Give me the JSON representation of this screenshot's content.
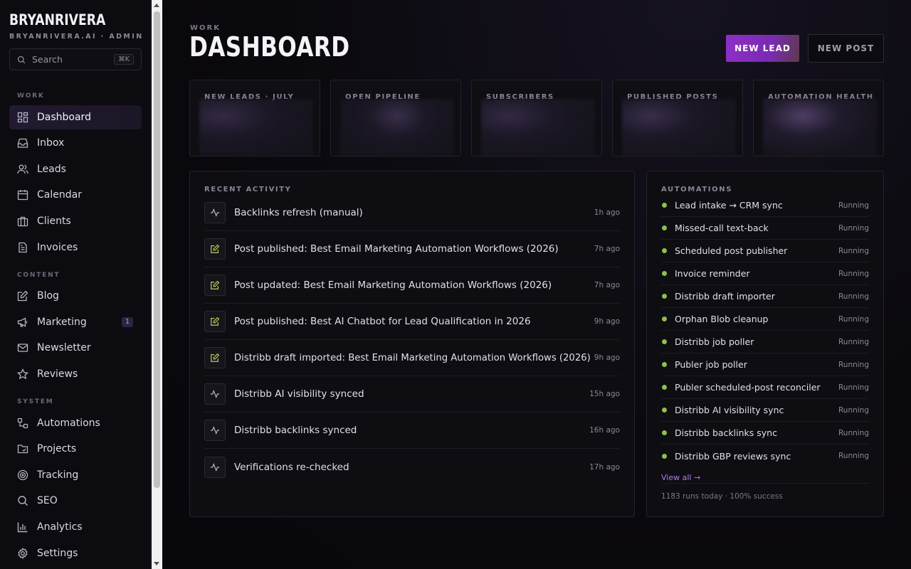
{
  "sidebar": {
    "brand": "BRYANRIVERA",
    "brand_sub": "BRYANRIVERA.AI · ADMIN",
    "search_placeholder": "Search",
    "search_shortcut": "⌘K",
    "sections": {
      "work": "WORK",
      "content": "CONTENT",
      "system": "SYSTEM"
    },
    "items": [
      {
        "label": "Dashboard",
        "icon": "grid-icon"
      },
      {
        "label": "Inbox",
        "icon": "inbox-icon"
      },
      {
        "label": "Leads",
        "icon": "users-icon"
      },
      {
        "label": "Calendar",
        "icon": "calendar-icon"
      },
      {
        "label": "Clients",
        "icon": "briefcase-icon"
      },
      {
        "label": "Invoices",
        "icon": "file-icon"
      },
      {
        "label": "Blog",
        "icon": "pen-square-icon"
      },
      {
        "label": "Marketing",
        "icon": "megaphone-icon",
        "badge": "1"
      },
      {
        "label": "Newsletter",
        "icon": "mail-icon"
      },
      {
        "label": "Reviews",
        "icon": "star-icon"
      },
      {
        "label": "Automations",
        "icon": "workflow-icon"
      },
      {
        "label": "Projects",
        "icon": "folder-icon"
      },
      {
        "label": "Tracking",
        "icon": "target-icon"
      },
      {
        "label": "SEO",
        "icon": "search-icon"
      },
      {
        "label": "Analytics",
        "icon": "bar-chart-icon"
      },
      {
        "label": "Settings",
        "icon": "gear-icon"
      }
    ]
  },
  "header": {
    "eyebrow": "WORK",
    "title": "DASHBOARD",
    "new_lead": "NEW LEAD",
    "new_post": "NEW POST"
  },
  "stats": [
    {
      "label": "NEW LEADS · JULY"
    },
    {
      "label": "OPEN PIPELINE"
    },
    {
      "label": "SUBSCRIBERS"
    },
    {
      "label": "PUBLISHED POSTS"
    },
    {
      "label": "AUTOMATION HEALTH"
    }
  ],
  "activity": {
    "title": "RECENT ACTIVITY",
    "items": [
      {
        "text": "Backlinks refresh (manual)",
        "time": "1h ago",
        "icon": "activity-icon"
      },
      {
        "text": "Post published: Best Email Marketing Automation Workflows (2026)",
        "time": "7h ago",
        "icon": "edit-icon"
      },
      {
        "text": "Post updated: Best Email Marketing Automation Workflows (2026)",
        "time": "7h ago",
        "icon": "edit-icon"
      },
      {
        "text": "Post published: Best AI Chatbot for Lead Qualification in 2026",
        "time": "9h ago",
        "icon": "edit-icon"
      },
      {
        "text": "Distribb draft imported: Best Email Marketing Automation Workflows (2026)",
        "time": "9h ago",
        "icon": "edit-icon"
      },
      {
        "text": "Distribb AI visibility synced",
        "time": "15h ago",
        "icon": "activity-icon"
      },
      {
        "text": "Distribb backlinks synced",
        "time": "16h ago",
        "icon": "activity-icon"
      },
      {
        "text": "Verifications re-checked",
        "time": "17h ago",
        "icon": "activity-icon"
      }
    ]
  },
  "automations": {
    "title": "AUTOMATIONS",
    "items": [
      {
        "name": "Lead intake → CRM sync",
        "status": "Running"
      },
      {
        "name": "Missed-call text-back",
        "status": "Running"
      },
      {
        "name": "Scheduled post publisher",
        "status": "Running"
      },
      {
        "name": "Invoice reminder",
        "status": "Running"
      },
      {
        "name": "Distribb draft importer",
        "status": "Running"
      },
      {
        "name": "Orphan Blob cleanup",
        "status": "Running"
      },
      {
        "name": "Distribb job poller",
        "status": "Running"
      },
      {
        "name": "Publer job poller",
        "status": "Running"
      },
      {
        "name": "Publer scheduled-post reconciler",
        "status": "Running"
      },
      {
        "name": "Distribb AI visibility sync",
        "status": "Running"
      },
      {
        "name": "Distribb backlinks sync",
        "status": "Running"
      },
      {
        "name": "Distribb GBP reviews sync",
        "status": "Running"
      }
    ],
    "view_all": "View all →",
    "footer": "1183 runs today · 100% success"
  },
  "colors": {
    "accent": "#8e2fc7",
    "status_running": "#8fbf4a",
    "link": "#b07de8"
  }
}
